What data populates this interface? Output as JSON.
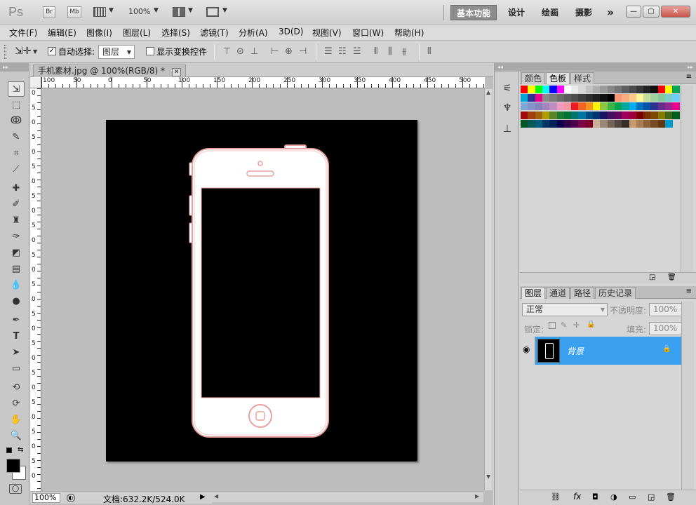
{
  "app": {
    "logo": "Ps",
    "bridge_label": "Br",
    "minibridge_label": "Mb",
    "zoom_display": "100%"
  },
  "workspaces": [
    "基本功能",
    "设计",
    "绘画",
    "摄影"
  ],
  "workspace_overflow": "»",
  "window_buttons": [
    "—",
    "▢",
    "✕"
  ],
  "menu": [
    "文件(F)",
    "编辑(E)",
    "图像(I)",
    "图层(L)",
    "选择(S)",
    "滤镜(T)",
    "分析(A)",
    "3D(D)",
    "视图(V)",
    "窗口(W)",
    "帮助(H)"
  ],
  "options": {
    "auto_select_label": "自动选择:",
    "auto_select_checked": true,
    "auto_select_value": "图层",
    "show_transform_label": "显示变换控件",
    "show_transform_checked": false
  },
  "document": {
    "tab_title": "手机素材.jpg @ 100%(RGB/8) *",
    "tab_close": "✕",
    "ruler_h_labels": [
      "100",
      "50",
      "0",
      "50",
      "100",
      "150",
      "200",
      "250",
      "300",
      "350",
      "400",
      "450",
      "500"
    ],
    "ruler_v_labels": [
      "0",
      "5",
      "0",
      "5",
      "0",
      "5",
      "0",
      "5",
      "0",
      "5",
      "0",
      "5",
      "0",
      "5",
      "0",
      "5",
      "0",
      "5",
      "0",
      "5",
      "0",
      "5",
      "0",
      "5",
      "0",
      "5",
      "0"
    ],
    "status_zoom": "100%",
    "status_doc_info": "文档:632.2K/524.0K"
  },
  "panels": {
    "swatch_tabs": [
      "颜色",
      "色板",
      "样式"
    ],
    "swatch_active": "色板",
    "layer_tabs": [
      "图层",
      "通道",
      "路径",
      "历史记录"
    ],
    "layer_active": "图层",
    "blend_mode": "正常",
    "opacity_label": "不透明度:",
    "opacity_value": "100%",
    "lock_label": "锁定:",
    "fill_label": "填充:",
    "fill_value": "100%",
    "layer_name": "背景"
  },
  "colors": {
    "layer_selected": "#3ba0ef",
    "phone_outline": "#e8a0a0",
    "canvas_bg": "#000000"
  },
  "swatches": [
    [
      "#ff0000",
      "#ffff00",
      "#00ff00",
      "#00ffff",
      "#0000ff",
      "#ff00ff",
      "#ffffff",
      "#ebebeb",
      "#d7d7d7",
      "#c3c3c3",
      "#afafaf",
      "#9b9b9b",
      "#878787",
      "#737373",
      "#5f5f5f",
      "#4b4b4b",
      "#373737",
      "#232323",
      "#0f0f0f",
      "#ff0000",
      "#ffff00",
      "#00a651"
    ],
    [
      "#00a6d6",
      "#2e3192",
      "#ec008c",
      "#898989",
      "#7a7a7a",
      "#6b6b6b",
      "#5c5c5c",
      "#4d4d4d",
      "#3e3e3e",
      "#2f2f2f",
      "#202020",
      "#111111",
      "#000000",
      "#f7977a",
      "#f9ad81",
      "#fdc68a",
      "#fff79a",
      "#c4df9b",
      "#a2d39c",
      "#82ca9d",
      "#7bcdc8",
      "#6ecff6"
    ],
    [
      "#7ea7d8",
      "#8493ca",
      "#8882be",
      "#a187be",
      "#bc8dbf",
      "#f49ac2",
      "#f6989d",
      "#ed1c24",
      "#f26522",
      "#f7941d",
      "#fff200",
      "#8dc63f",
      "#39b54a",
      "#00a651",
      "#00a99d",
      "#00aeef",
      "#0072bc",
      "#0054a6",
      "#2e3192",
      "#662d91",
      "#92278f",
      "#ec008c"
    ],
    [
      "#9e0b0f",
      "#a0410d",
      "#a3620a",
      "#aba000",
      "#598527",
      "#197b30",
      "#007236",
      "#00746b",
      "#0076a3",
      "#004b80",
      "#003471",
      "#1b1464",
      "#440e62",
      "#630460",
      "#9e005d",
      "#9e0039",
      "#790000",
      "#7b2e00",
      "#7d4900",
      "#827b00",
      "#406618",
      "#005e20"
    ],
    [
      "#005826",
      "#005952",
      "#005b7f",
      "#003663",
      "#002157",
      "#0d004c",
      "#32004b",
      "#4b0049",
      "#7b0046",
      "#7a0026",
      "#c7b299",
      "#998675",
      "#736357",
      "#534741",
      "#37302a",
      "#c69c6d",
      "#a67c52",
      "#8c6239",
      "#754c24",
      "#603913",
      "#0099cc"
    ]
  ]
}
